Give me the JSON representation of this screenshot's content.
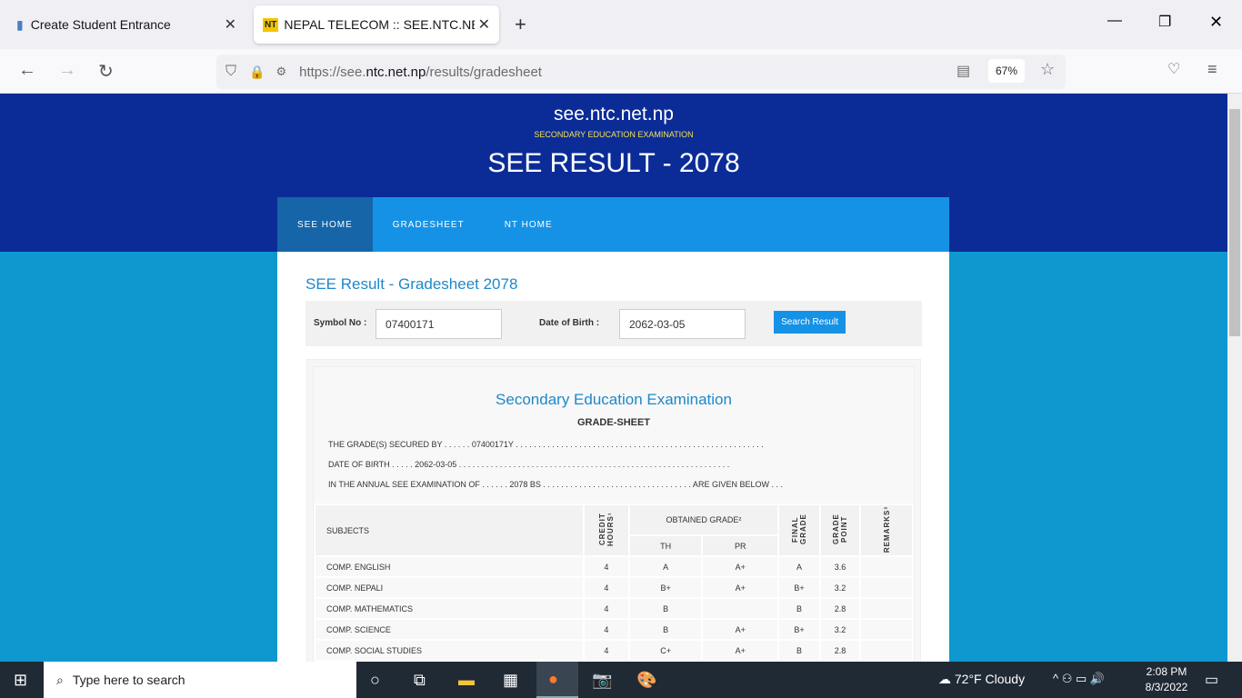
{
  "browser": {
    "tabs": [
      {
        "label": "Create Student Entrance",
        "active": false
      },
      {
        "label": "NEPAL TELECOM :: SEE.NTC.NET.N",
        "active": true
      }
    ],
    "url_prefix": "https://see.",
    "url_domain": "ntc.net.np",
    "url_path": "/results/gradesheet",
    "zoom": "67%"
  },
  "header": {
    "site": "see.ntc.net.np",
    "subtitle": "SECONDARY EDUCATION EXAMINATION",
    "title": "SEE RESULT - 2078"
  },
  "nav": [
    "SEE HOME",
    "GRADESHEET",
    "NT HOME"
  ],
  "page_title": "SEE Result - Gradesheet 2078",
  "form": {
    "symbol_label": "Symbol No :",
    "symbol_value": "07400171",
    "dob_label": "Date of Birth :",
    "dob_value": "2062-03-05",
    "button": "Search Result"
  },
  "sheet": {
    "title": "Secondary Education Examination",
    "subtitle": "GRADE-SHEET",
    "line1": "THE GRADE(S) SECURED BY . . . . . . 07400171Y . . . . . . . . . . . . . . . . . . . . . . . . . . . . . . . . . . . . . . . . . . . . . . . . . . . . . . .",
    "line2": "DATE OF BIRTH . . . . . 2062-03-05 . . . . . . . . . . . . . . . . . . . . . . . . . . . . . . . . . . . . . . . . . . . . . . . . . . . . . . . . . . . .",
    "line3": "IN THE ANNUAL SEE EXAMINATION OF . . . . . . 2078 BS . . . . . . . . . . . . . . . . . . . . . . . . . . . . . . . . . ARE GIVEN BELOW . . .",
    "headers": {
      "subjects": "SUBJECTS",
      "credit": "CREDIT HOURS¹",
      "obtained": "OBTAINED GRADE²",
      "th": "TH",
      "pr": "PR",
      "final": "FINAL GRADE",
      "point": "GRADE POINT",
      "remarks": "REMARKS³"
    },
    "rows": [
      [
        "COMP. ENGLISH",
        "4",
        "A",
        "A+",
        "A",
        "3.6",
        ""
      ],
      [
        "COMP. NEPALI",
        "4",
        "B+",
        "A+",
        "B+",
        "3.2",
        ""
      ],
      [
        "COMP. MATHEMATICS",
        "4",
        "B",
        "",
        "B",
        "2.8",
        ""
      ],
      [
        "COMP. SCIENCE",
        "4",
        "B",
        "A+",
        "B+",
        "3.2",
        ""
      ],
      [
        "COMP. SOCIAL STUDIES",
        "4",
        "C+",
        "A+",
        "B",
        "2.8",
        ""
      ]
    ]
  },
  "taskbar": {
    "search": "Type here to search",
    "weather": "72°F  Cloudy",
    "time": "2:08 PM",
    "date": "8/3/2022"
  }
}
